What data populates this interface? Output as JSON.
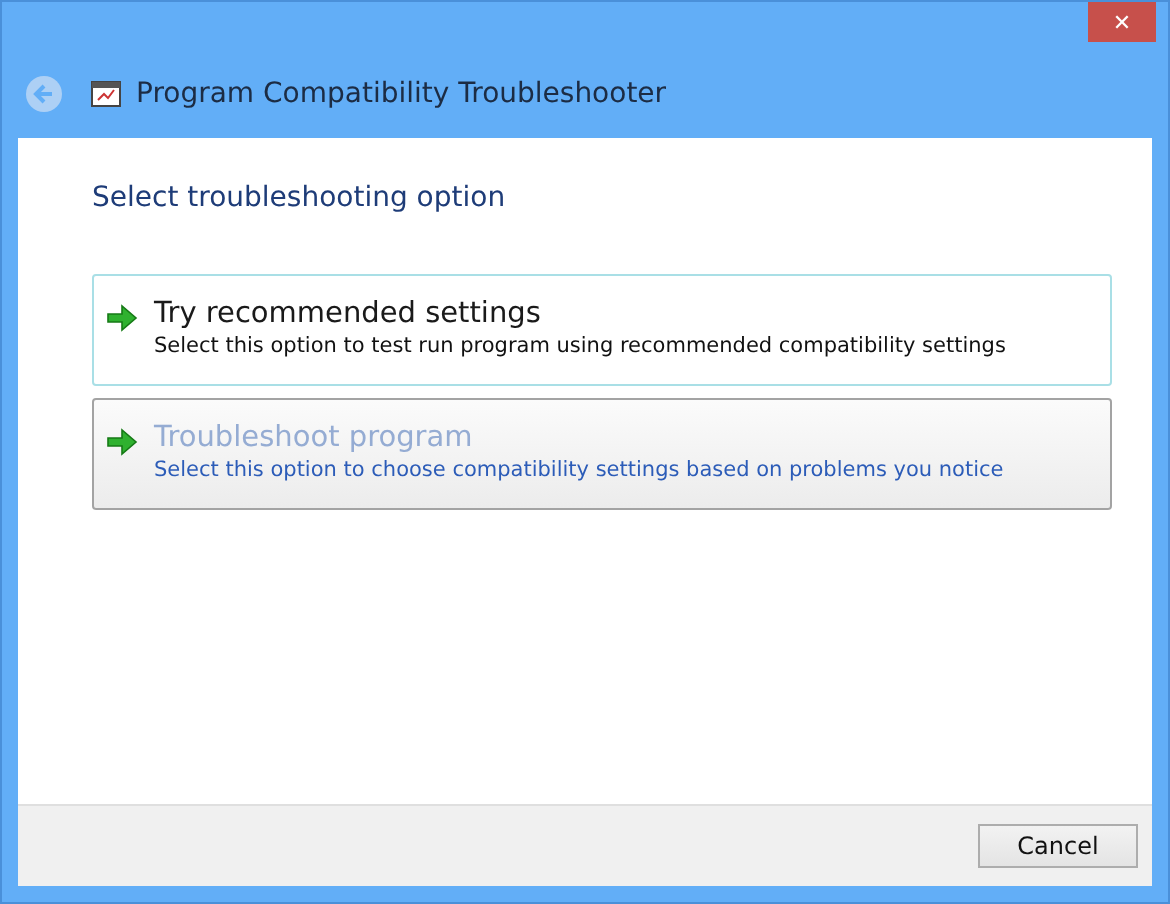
{
  "window": {
    "close": "✕",
    "title": "Program Compatibility Troubleshooter",
    "back_disabled": true
  },
  "heading": "Select troubleshooting option",
  "options": [
    {
      "title": "Try recommended settings",
      "description": "Select this option to test run program using recommended compatibility settings",
      "focused": true,
      "hovered": false
    },
    {
      "title": "Troubleshoot program",
      "description": "Select this option to choose compatibility settings based on problems you notice",
      "focused": false,
      "hovered": true
    }
  ],
  "buttons": [
    "Cancel"
  ]
}
